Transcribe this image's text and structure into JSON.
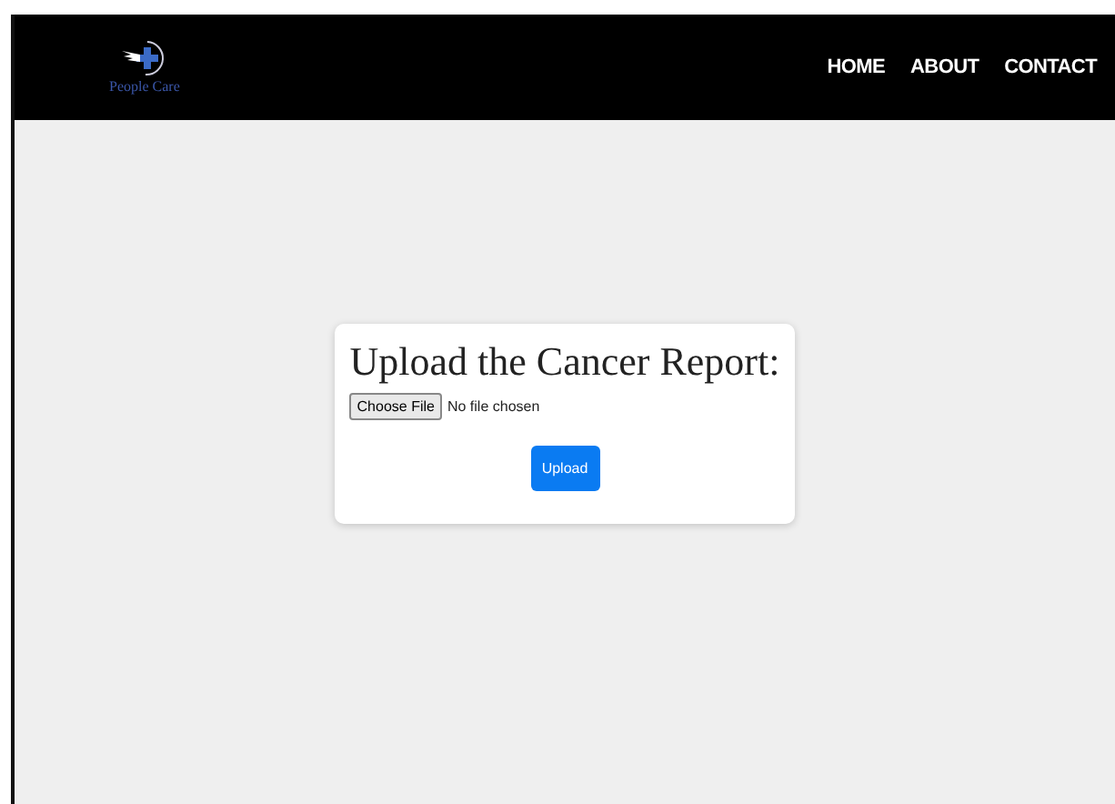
{
  "header": {
    "logo_text": "People Care",
    "nav": [
      "HOME",
      "ABOUT",
      "CONTACT"
    ]
  },
  "upload_card": {
    "title": "Upload the Cancer Report:",
    "file_button": "Choose File",
    "file_status": "No file chosen",
    "submit": "Upload"
  }
}
